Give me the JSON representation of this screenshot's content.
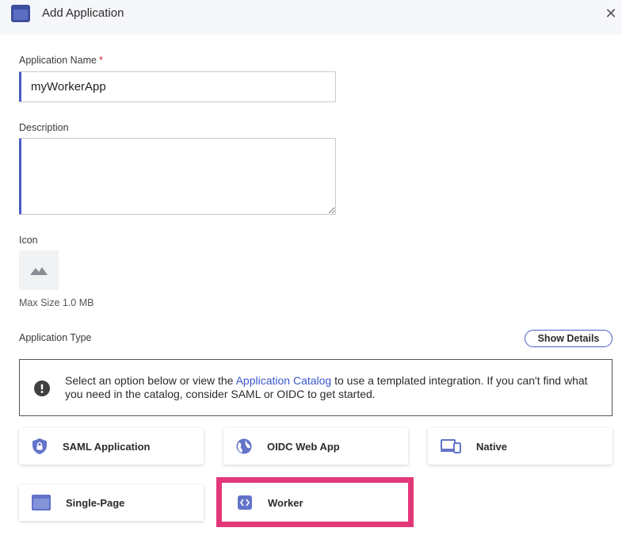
{
  "header": {
    "title": "Add Application",
    "close_glyph": "✕",
    "icon": "window-icon"
  },
  "form": {
    "name_label": "Application Name",
    "required_mark": "*",
    "name_value": "myWorkerApp",
    "description_label": "Description",
    "description_value": "",
    "icon_label": "Icon",
    "max_size": "Max Size 1.0 MB"
  },
  "app_type": {
    "label": "Application Type",
    "show_details": "Show Details",
    "info_before": "Select an option below or view the ",
    "info_link": "Application Catalog",
    "info_after": " to use a templated integration. If you can't find what you need in the catalog, consider SAML or OIDC to get started.",
    "types": [
      {
        "label": "SAML Application",
        "icon": "shield-lock-icon"
      },
      {
        "label": "OIDC Web App",
        "icon": "globe-icon"
      },
      {
        "label": "Native",
        "icon": "devices-icon"
      },
      {
        "label": "Single-Page",
        "icon": "browser-window-icon"
      },
      {
        "label": "Worker",
        "icon": "code-icon",
        "highlighted": true
      }
    ]
  },
  "colors": {
    "accent": "#4a5bc4",
    "icon": "#6273c9",
    "highlight": "#e23778",
    "link": "#3b56cc"
  }
}
